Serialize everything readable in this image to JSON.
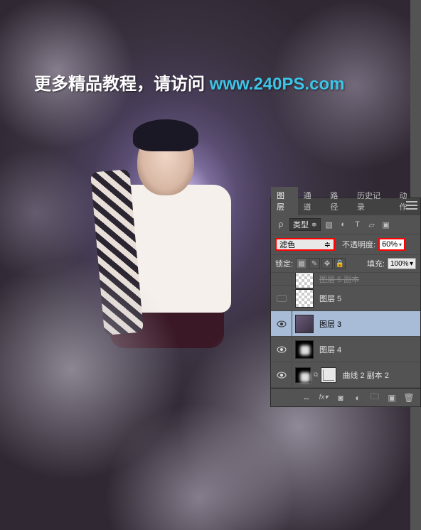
{
  "watermark": {
    "prefix": "更多精品教程，请访问 ",
    "url": "www.240PS.com"
  },
  "panel": {
    "tabs": [
      "图层",
      "通道",
      "路径",
      "历史记录",
      "动作"
    ],
    "active_tab": 0,
    "filter_label": "类型",
    "blend_mode": "滤色",
    "opacity_label": "不透明度:",
    "opacity_value": "60%",
    "lock_label": "锁定:",
    "fill_label": "填充:",
    "fill_value": "100%",
    "layers": [
      {
        "name": "图层 5 副本",
        "visible": false,
        "partial": true
      },
      {
        "name": "图层 5",
        "visible": false,
        "thumb": "checker"
      },
      {
        "name": "图层 3",
        "visible": true,
        "selected": true,
        "thumb": "image"
      },
      {
        "name": "图层 4",
        "visible": true,
        "thumb": "mask"
      },
      {
        "name": "曲线 2 副本 2",
        "visible": true,
        "thumb": "curves",
        "has_mask": true
      }
    ]
  }
}
